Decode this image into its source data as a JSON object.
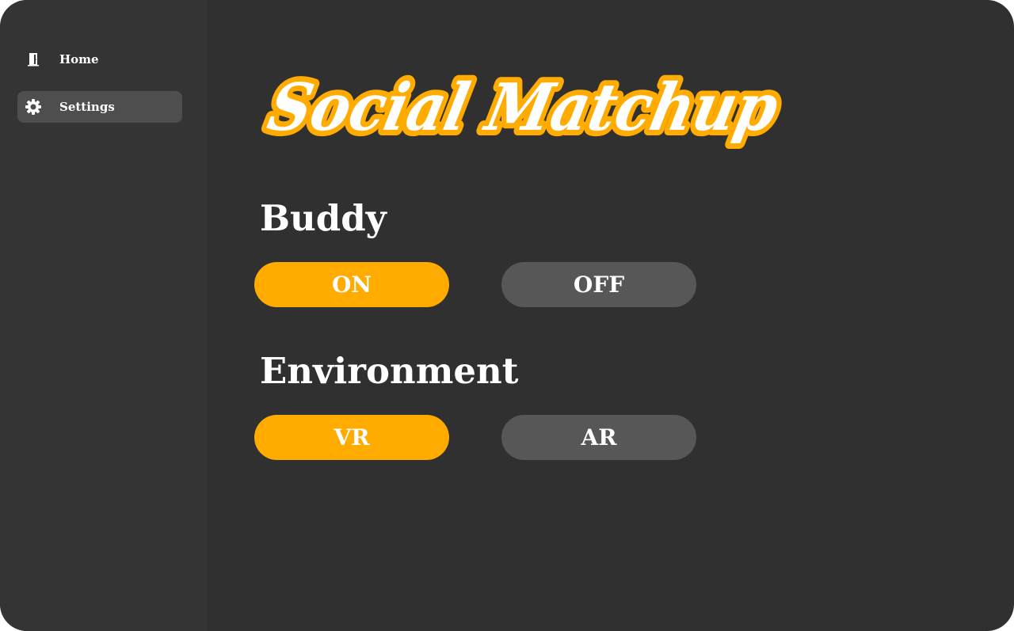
{
  "app": {
    "title": "Social Matchup"
  },
  "colors": {
    "background": "#303030",
    "sidebar": "#343434",
    "accent": "#ffab00",
    "button_inactive": "#575757",
    "nav_active": "#4e4e4e",
    "text": "#ffffff"
  },
  "sidebar": {
    "items": [
      {
        "label": "Home",
        "icon": "door-icon",
        "active": false
      },
      {
        "label": "Settings",
        "icon": "gear-icon",
        "active": true
      }
    ]
  },
  "settings": {
    "buddy": {
      "label": "Buddy",
      "options": [
        "ON",
        "OFF"
      ],
      "selected": "ON"
    },
    "environment": {
      "label": "Environment",
      "options": [
        "VR",
        "AR"
      ],
      "selected": "VR"
    }
  }
}
